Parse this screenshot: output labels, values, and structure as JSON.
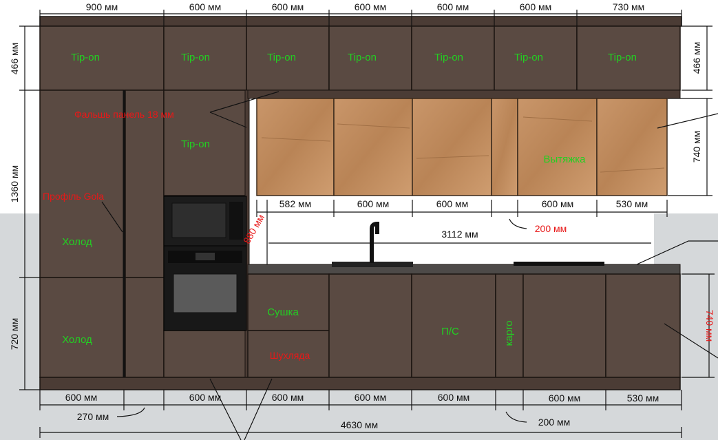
{
  "top_dims": [
    "900 мм",
    "600 мм",
    "600 мм",
    "600 мм",
    "600 мм",
    "600 мм",
    "730 мм"
  ],
  "side_dims": {
    "left_top": "466 мм",
    "left_mid": "1360 мм",
    "left_bottom": "720 мм",
    "right_top": "466 мм",
    "right_mid": "740 мм",
    "right_bottom": "740 мм"
  },
  "upper_dims": [
    "582 мм",
    "600 мм",
    "600 мм",
    "600 мм",
    "530 мм"
  ],
  "gap_dim": "200 мм",
  "niche_width": "3112 мм",
  "niche_height": "880 мм",
  "bottom_dims": [
    "600 мм",
    "600 мм",
    "600 мм",
    "600 мм",
    "600 мм",
    "600 мм",
    "530 мм"
  ],
  "bottom_extra": {
    "left": "270 мм",
    "right": "200 мм"
  },
  "total_width": "4630 мм",
  "labels": {
    "tipon": "Tip-on",
    "hood": "Вытяжка",
    "cold": "Холод",
    "dryer": "Сушка",
    "drawers": "Шухляда",
    "ps": "П/С",
    "cargo": "карго",
    "false_panel": "Фальшь панель 18 мм",
    "profile": "Профіль Gola"
  },
  "colors": {
    "cabinet": "#5a4a42",
    "wood": "#c28d5e",
    "label_green": "#22d022",
    "label_red": "#e81818"
  }
}
